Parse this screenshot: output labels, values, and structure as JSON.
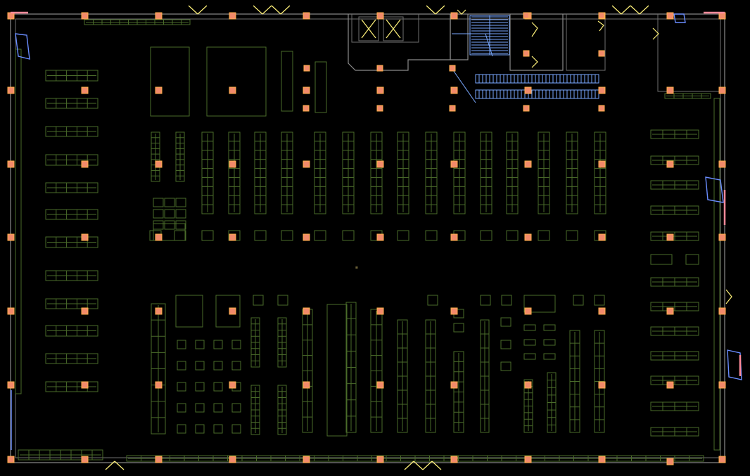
{
  "drawing": {
    "kind": "floor-plan",
    "colors": {
      "background": "#000000",
      "shelving": "#4a6b2a",
      "columns": "#f28a6a",
      "column_stroke": "#ffb14a",
      "walls": "#8a8a8a",
      "glass": "#6a8dff",
      "escalator": "#7aa9ff",
      "doors": "#fff27a",
      "wall_accent": "#ff8a9a",
      "marker": "#d8c070"
    },
    "center_marker_text": "≡"
  }
}
